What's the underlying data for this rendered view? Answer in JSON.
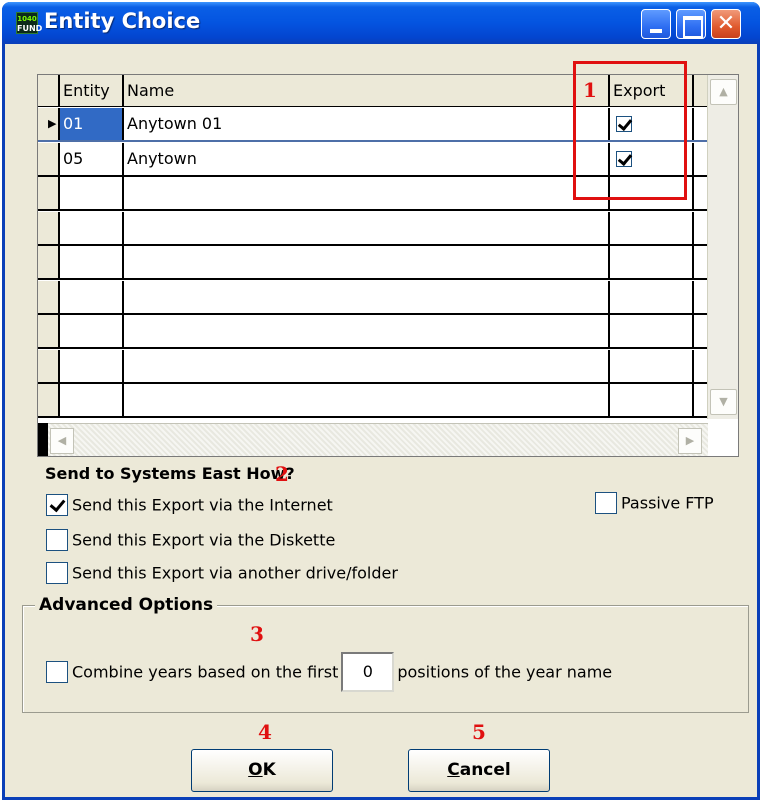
{
  "window": {
    "title": "Entity Choice",
    "app_icon_top": "1040",
    "app_icon_bottom": "FUND",
    "close_glyph": "✕"
  },
  "grid": {
    "headers": {
      "entity": "Entity",
      "name": "Name",
      "export": "Export"
    },
    "rows": [
      {
        "entity": "01",
        "name": "Anytown 01",
        "export": true,
        "selected": true
      },
      {
        "entity": "05",
        "name": "Anytown",
        "export": true,
        "selected": false
      }
    ],
    "empty_row_count": 7,
    "row_indicator_glyph": "▶",
    "scroll_up_glyph": "▲",
    "scroll_down_glyph": "▼",
    "scroll_left_glyph": "◀",
    "scroll_right_glyph": "▶"
  },
  "annotations": {
    "m1": "1",
    "m2": "2",
    "m3": "3",
    "m4": "4",
    "m5": "5",
    "highlight_color": "#e01010"
  },
  "send": {
    "heading": "Send to Systems East How?",
    "internet": {
      "label": "Send this Export via the Internet",
      "checked": true
    },
    "diskette": {
      "label": "Send this Export via the Diskette",
      "checked": false
    },
    "drive": {
      "label": "Send this Export via another drive/folder",
      "checked": false
    },
    "passive_ftp": {
      "label": "Passive FTP",
      "checked": false
    }
  },
  "advanced": {
    "legend": "Advanced Options",
    "combine_prefix": "Combine years based on the first",
    "combine_value": "0",
    "combine_suffix": "positions of the year name",
    "combine_checked": false
  },
  "buttons": {
    "ok_underlined": "O",
    "ok_rest": "K",
    "cancel_underlined": "C",
    "cancel_rest": "ancel"
  },
  "colors": {
    "titlebar": "#0454e0",
    "selection": "#316ac5",
    "face": "#ece9d8"
  }
}
